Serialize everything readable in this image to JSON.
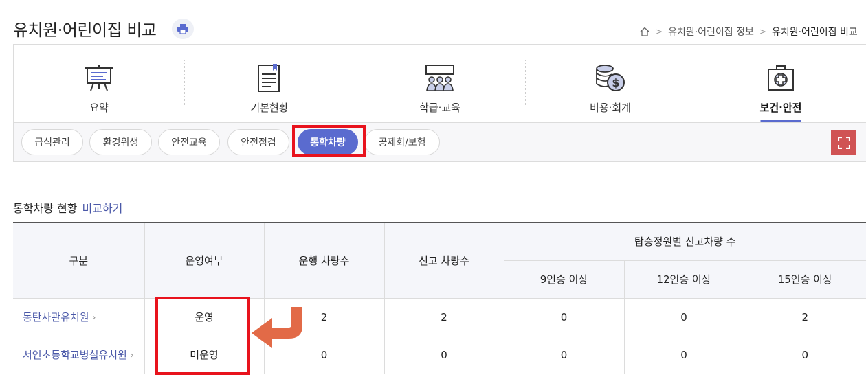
{
  "page": {
    "title": "유치원·어린이집 비교"
  },
  "breadcrumb": {
    "items": [
      "유치원·어린이집 정보",
      "유치원·어린이집 비교"
    ]
  },
  "categories": [
    {
      "label": "요약",
      "icon": "presentation-board-icon",
      "active": false
    },
    {
      "label": "기본현황",
      "icon": "document-icon",
      "active": false
    },
    {
      "label": "학급·교육",
      "icon": "classroom-people-icon",
      "active": false
    },
    {
      "label": "비용·회계",
      "icon": "coins-dollar-icon",
      "active": false
    },
    {
      "label": "보건·안전",
      "icon": "first-aid-kit-icon",
      "active": true
    }
  ],
  "sub_tabs": [
    {
      "label": "급식관리",
      "active": false
    },
    {
      "label": "환경위생",
      "active": false
    },
    {
      "label": "안전교육",
      "active": false
    },
    {
      "label": "안전점검",
      "active": false
    },
    {
      "label": "통학차량",
      "active": true
    },
    {
      "label": "공제회/보험",
      "active": false
    }
  ],
  "section": {
    "title": "통학차량 현황",
    "subtitle": "비교하기"
  },
  "table": {
    "headers": {
      "category": "구분",
      "operation": "운영여부",
      "vehicles_operating": "운행 차량수",
      "vehicles_reported": "신고 차량수",
      "group": "탑승정원별 신고차량 수",
      "cap9": "9인승 이상",
      "cap12": "12인승 이상",
      "cap15": "15인승 이상"
    },
    "rows": [
      {
        "name": "동탄사관유치원",
        "chevron": "›",
        "operation": "운영",
        "vehicles_operating": "2",
        "vehicles_reported": "2",
        "cap9": "0",
        "cap12": "0",
        "cap15": "2"
      },
      {
        "name": "서연초등학교병설유치원",
        "chevron": "›",
        "operation": "미운영",
        "vehicles_operating": "0",
        "vehicles_reported": "0",
        "cap9": "0",
        "cap12": "0",
        "cap15": "0"
      }
    ]
  },
  "colors": {
    "accent": "#5a6bcf",
    "highlight_box": "#e8131d",
    "arrow": "#e26a47",
    "fullscreen_button": "#d05354",
    "link": "#4a58a8"
  }
}
